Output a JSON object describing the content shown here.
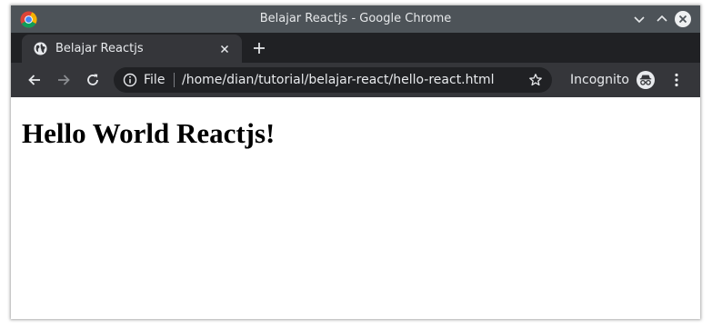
{
  "window": {
    "title": "Belajar Reactjs - Google Chrome"
  },
  "tabs": [
    {
      "title": "Belajar Reactjs",
      "active": true,
      "favicon": "globe-icon"
    }
  ],
  "toolbar": {
    "scheme_label": "File",
    "url": "/home/dian/tutorial/belajar-react/hello-react.html",
    "incognito_label": "Incognito"
  },
  "page": {
    "heading": "Hello World Reactjs!"
  },
  "colors": {
    "titlebar": "#4d5358",
    "tabstrip": "#202124",
    "active_tab": "#35363a",
    "omnibox": "#202124",
    "text_light": "#e8eaed"
  }
}
